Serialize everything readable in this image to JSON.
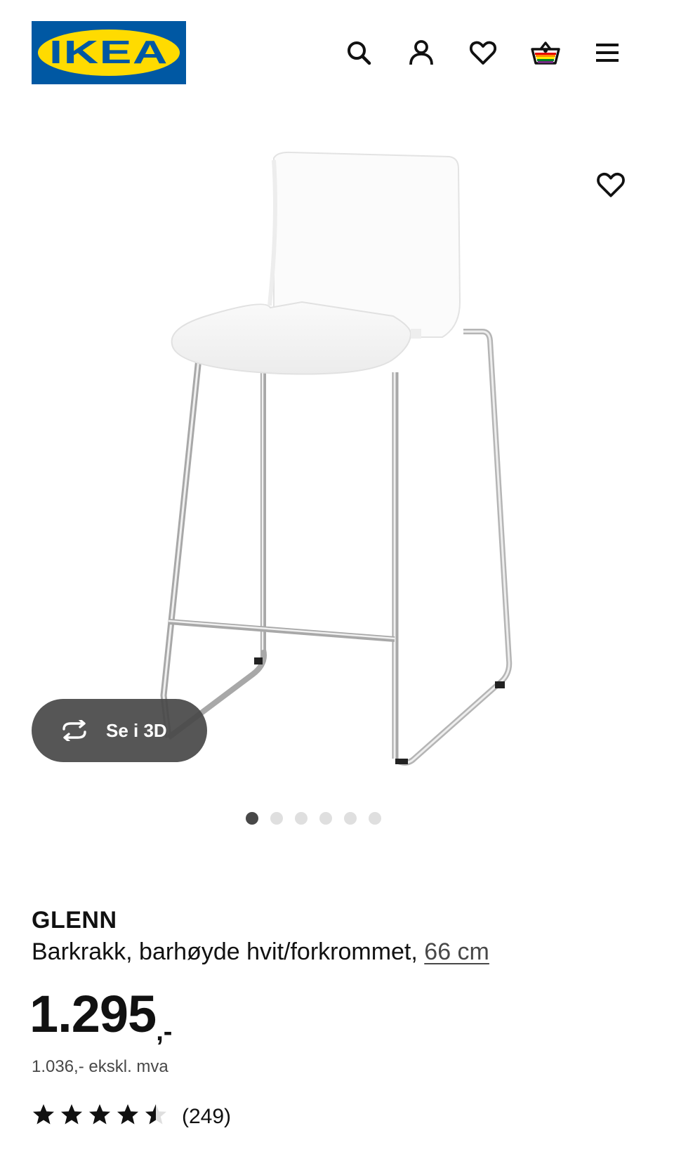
{
  "header": {
    "logo_text": "IKEA",
    "icons": [
      "search-icon",
      "account-icon",
      "favourites-icon",
      "shopping-cart-icon",
      "menu-icon"
    ]
  },
  "gallery": {
    "view_3d_label": "Se i 3D",
    "image_count": 6,
    "active_index": 0
  },
  "product": {
    "name": "GLENN",
    "description": "Barkrakk, barhøyde hvit/forkrommet,",
    "size_link": "66 cm",
    "price": "1.295",
    "price_suffix": ",-",
    "price_excl_vat": "1.036,- ekskl. mva",
    "rating_value": 4.5,
    "rating_max": 5,
    "review_count": "(249)"
  },
  "colors": {
    "brand_blue": "#0058A3",
    "brand_yellow": "#FFDB00",
    "text": "#111111",
    "secondary_text": "#484848",
    "pill_background": "#484848"
  }
}
